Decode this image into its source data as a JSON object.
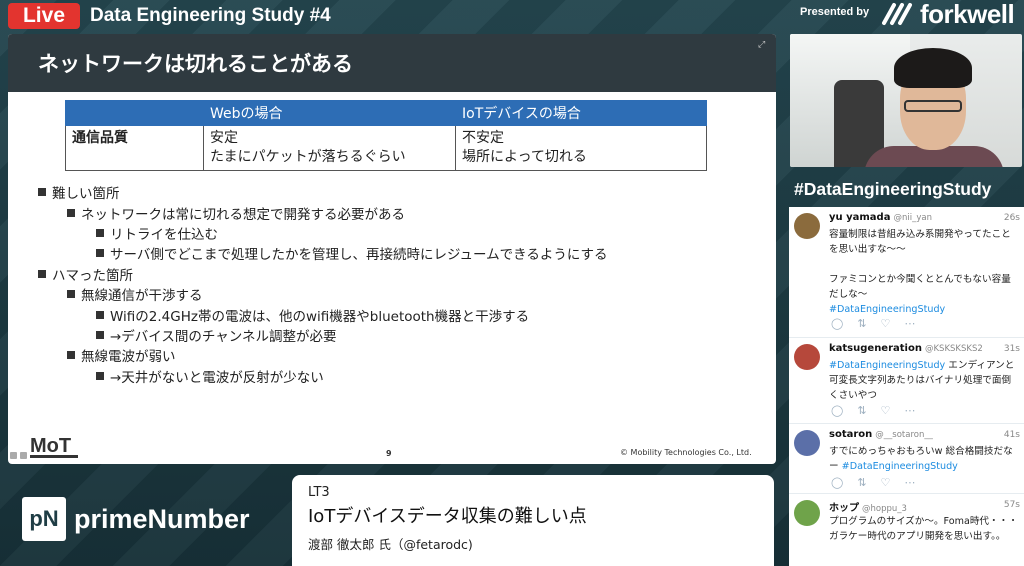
{
  "topbar": {
    "live": "Live",
    "event_title": "Data Engineering Study #4",
    "presented_by": "Presented by",
    "sponsor_logo": "forkwell"
  },
  "slide": {
    "title": "ネットワークは切れることがある",
    "table": {
      "headers": [
        "",
        "Webの場合",
        "IoTデバイスの場合"
      ],
      "rows": [
        {
          "label": "通信品質",
          "web": "安定\nたまにパケットが落ちるぐらい",
          "iot": "不安定\n場所によって切れる"
        }
      ]
    },
    "bullets": [
      {
        "level": 1,
        "text": "難しい箇所"
      },
      {
        "level": 2,
        "text": "ネットワークは常に切れる想定で開発する必要がある"
      },
      {
        "level": 3,
        "text": "リトライを仕込む"
      },
      {
        "level": 3,
        "text": "サーバ側でどこまで処理したかを管理し、再接続時にレジュームできるようにする"
      },
      {
        "level": 1,
        "text": "ハマった箇所"
      },
      {
        "level": 2,
        "text": "無線通信が干渉する"
      },
      {
        "level": 3,
        "text": "Wifiの2.4GHz帯の電波は、他のwifi機器やbluetooth機器と干渉する"
      },
      {
        "level": 3,
        "text": "→デバイス間のチャンネル調整が必要"
      },
      {
        "level": 2,
        "text": "無線電波が弱い"
      },
      {
        "level": 3,
        "text": "→天井がないと電波が反射が少ない"
      }
    ],
    "logo_text": "MoT",
    "page_number": "9",
    "copyright": "© Mobility Technologies Co., Ltd."
  },
  "hashtag": "#DataEngineeringStudy",
  "tweets": [
    {
      "user": "yu yamada",
      "handle": "@nii_yan",
      "time": "26s",
      "text": "容量制限は昔組み込み系開発やってたことを思い出すな〜〜\n\nファミコンとか今聞くととんでもない容量だしな〜",
      "tag": "#DataEngineeringStudy",
      "avatar_color": "#8b6b3d"
    },
    {
      "user": "katsugeneration",
      "handle": "@KSKSKSKS2",
      "time": "31s",
      "tag": "#DataEngineeringStudy",
      "text": " エンディアンと可変長文字列あたりはバイナリ処理で面倒くさいやつ",
      "avatar_color": "#b6483b"
    },
    {
      "user": "sotaron",
      "handle": "@__sotaron__",
      "time": "41s",
      "text": "すでにめっちゃおもろいw 総合格闘技だなー ",
      "tag": "#DataEngineeringStudy",
      "avatar_color": "#5b6fa8"
    },
    {
      "user": "ホップ",
      "handle": "@hoppu_3",
      "time": "57s",
      "text": "プログラムのサイズか〜。Foma時代・・・ガラケー時代のアプリ開発を思い出す。。",
      "tag": "",
      "avatar_color": "#6fa34a"
    }
  ],
  "sponsor": {
    "mark": "pN",
    "name": "primeNumber"
  },
  "talk": {
    "label": "LT3",
    "title": "IoTデバイスデータ収集の難しい点",
    "speaker": "渡部 徹太郎 氏（@fetarodc)"
  },
  "colors": {
    "live_red": "#e3342f",
    "table_header_blue": "#2d6db5",
    "slide_header": "#2f3a40",
    "link_blue": "#1d8ce0"
  }
}
